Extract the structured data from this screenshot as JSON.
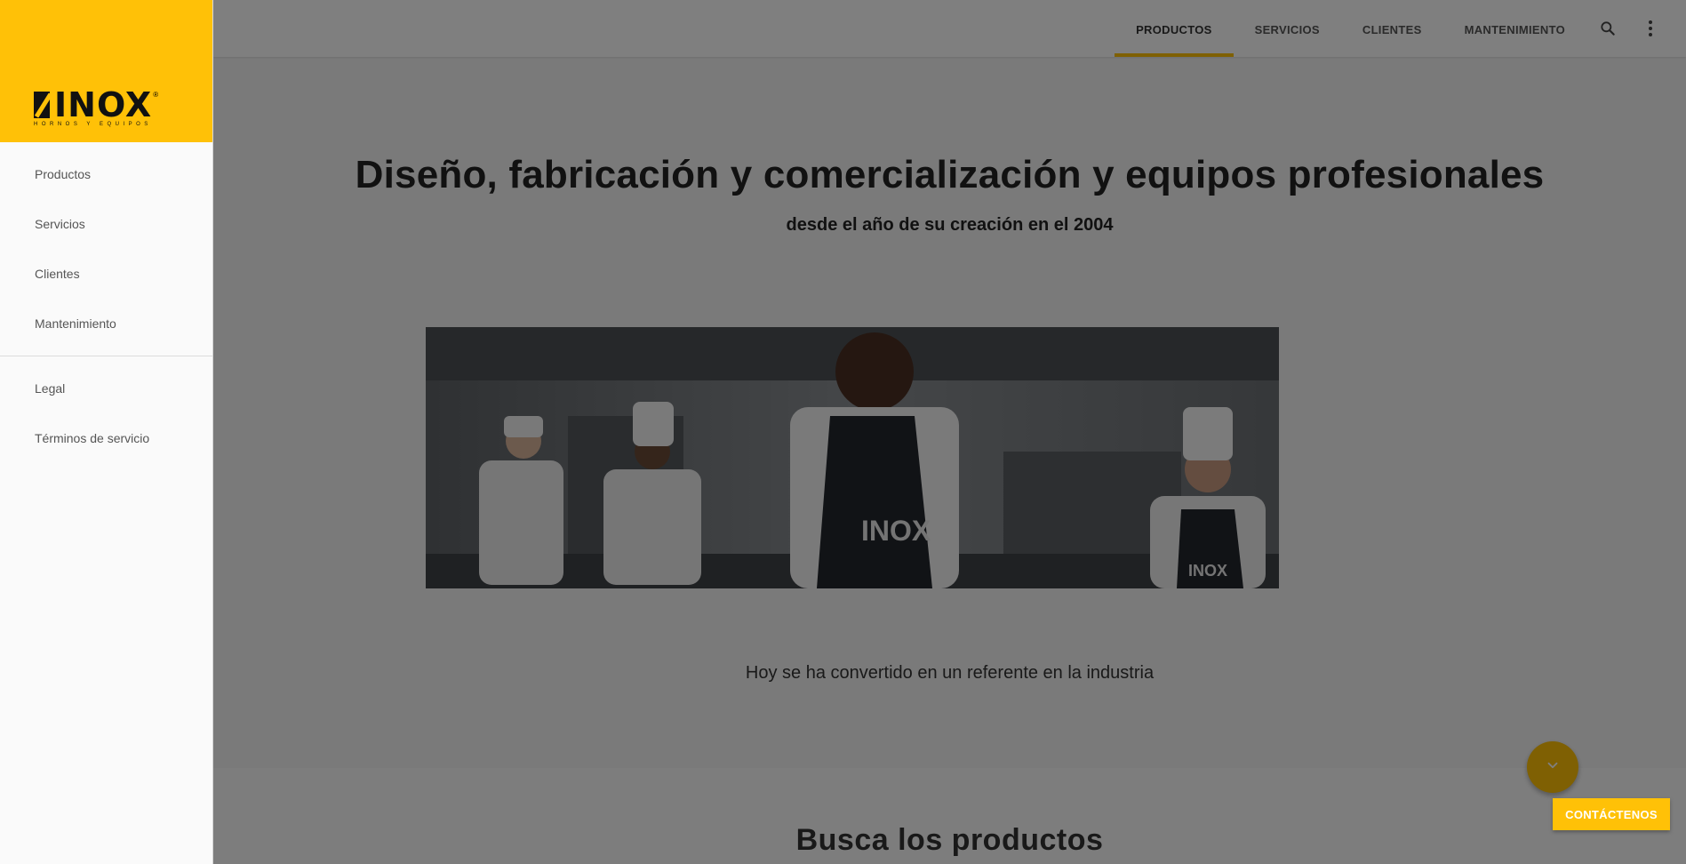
{
  "brand": {
    "name": "INOX",
    "tagline": "HORNOS Y EQUIPOS",
    "registered": "®",
    "color": "#ffc107"
  },
  "drawer": {
    "items": [
      {
        "label": "Productos"
      },
      {
        "label": "Servicios"
      },
      {
        "label": "Clientes"
      },
      {
        "label": "Mantenimiento"
      }
    ],
    "secondary_items": [
      {
        "label": "Legal"
      },
      {
        "label": "Términos de servicio"
      }
    ]
  },
  "topbar": {
    "tabs": [
      {
        "label": "PRODUCTOS",
        "active": true
      },
      {
        "label": "SERVICIOS",
        "active": false
      },
      {
        "label": "CLIENTES",
        "active": false
      },
      {
        "label": "MANTENIMIENTO",
        "active": false
      }
    ],
    "icons": [
      "search-icon",
      "more-vert-icon"
    ]
  },
  "hero": {
    "title": "Diseño, fabricación y comercialización y equipos profesionales",
    "subtitle": "desde el año de su creación en el 2004",
    "caption": "Hoy se ha convertido en un referente en la industria",
    "apron_logo": "INOX"
  },
  "section2": {
    "title": "Busca los productos"
  },
  "fab": {
    "icon": "chevron-down-icon"
  },
  "contact": {
    "label": "CONTÁCTENOS"
  }
}
